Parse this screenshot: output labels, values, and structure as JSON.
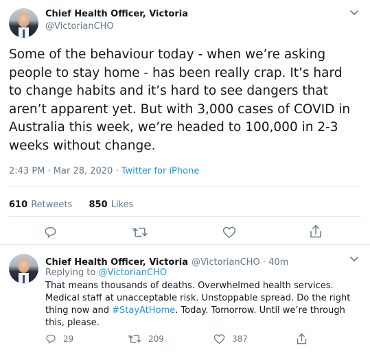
{
  "tweet": {
    "author_name": "Chief Health Officer, Victoria",
    "author_handle": "@VictorianCHO",
    "text": "Some of the behaviour today - when we’re asking people to stay home - has been really crap. It’s hard to change habits and it’s hard to see dangers that aren’t apparent yet. But with 3,000 cases of COVID in Australia this week, we’re headed to 100,000 in 2-3 weeks without change.",
    "timestamp": "2:43 PM · Mar 28, 2020",
    "separator": " · ",
    "source": "Twitter for iPhone",
    "retweets_count": "610",
    "retweets_label": "Retweets",
    "likes_count": "850",
    "likes_label": "Likes"
  },
  "reply": {
    "author_name": "Chief Health Officer, Victoria",
    "author_handle": "@VictorianCHO",
    "time_ago": " · 40m",
    "replying_prefix": "Replying to ",
    "replying_to": "@VictorianCHO",
    "text_before": "That means thousands of deaths. Overwhelmed health services. Medical staff at unacceptable risk. Unstoppable spread. Do the right thing now and ",
    "hashtag": "#StayAtHome",
    "text_after": ". Today. Tomorrow. Until we’re through this, please.",
    "reply_count": "29",
    "retweet_count": "209",
    "like_count": "387"
  },
  "icons": {
    "menu": "chevron-down-icon",
    "reply": "reply-icon",
    "retweet": "retweet-icon",
    "like": "like-icon",
    "share": "share-icon"
  },
  "colors": {
    "link": "#1b95e0",
    "secondary_text": "#657786",
    "divider": "#e6ecf0"
  }
}
